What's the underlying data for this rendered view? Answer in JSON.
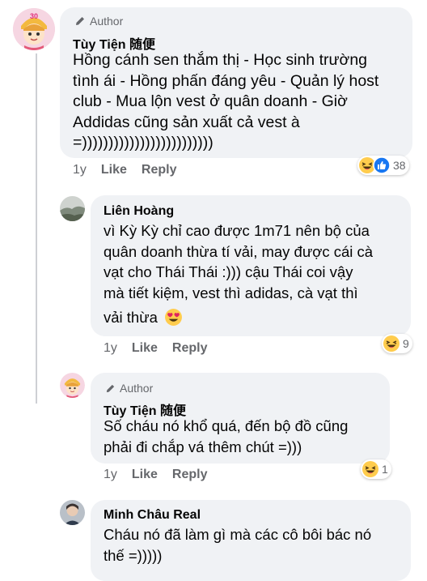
{
  "comments": [
    {
      "author_badge": "Author",
      "name": "Tùy Tiện 随便",
      "lines": [
        "Hồng cánh sen thắm thị - Học sinh trường",
        "tình ái - Hồng phấn đáng yêu - Quản lý host",
        "club - Mua lộn vest ở quân doanh - Giờ",
        "Addidas cũng sản xuất cả vest à",
        "=)))))))))))))))))))))))))"
      ],
      "time": "1y",
      "like": "Like",
      "reply": "Reply",
      "reaction_count": "38",
      "reactions": [
        "laugh",
        "like"
      ]
    },
    {
      "name": "Liên Hoàng",
      "lines": [
        "vì Kỳ Kỳ chỉ cao được 1m71 nên bộ của",
        "quân doanh thừa tí vải, may được cái cà",
        "vạt cho Thái Thái :))) cậu Thái coi vậy",
        "mà tiết kiệm, vest thì adidas, cà vạt thì",
        "vải thừa"
      ],
      "trailing_emoji": "heart-eyes",
      "time": "1y",
      "like": "Like",
      "reply": "Reply",
      "reaction_count": "9",
      "reactions": [
        "laugh"
      ]
    },
    {
      "author_badge": "Author",
      "name": "Tùy Tiện 随便",
      "lines": [
        "Số cháu nó khổ quá, đến bộ đồ cũng",
        "phải đi chắp vá thêm chút =)))"
      ],
      "time": "1y",
      "like": "Like",
      "reply": "Reply",
      "reaction_count": "1",
      "reactions": [
        "laugh"
      ]
    },
    {
      "name": "Minh Châu Real",
      "lines": [
        "Cháu nó đã làm gì mà các cô bôi bác nó",
        "thế =)))))"
      ]
    }
  ],
  "colors": {
    "bubble": "#f0f2f5",
    "meta_text": "#65676b",
    "like_blue": "#1877f2",
    "emoji_yellow": "#ffcc4d"
  }
}
